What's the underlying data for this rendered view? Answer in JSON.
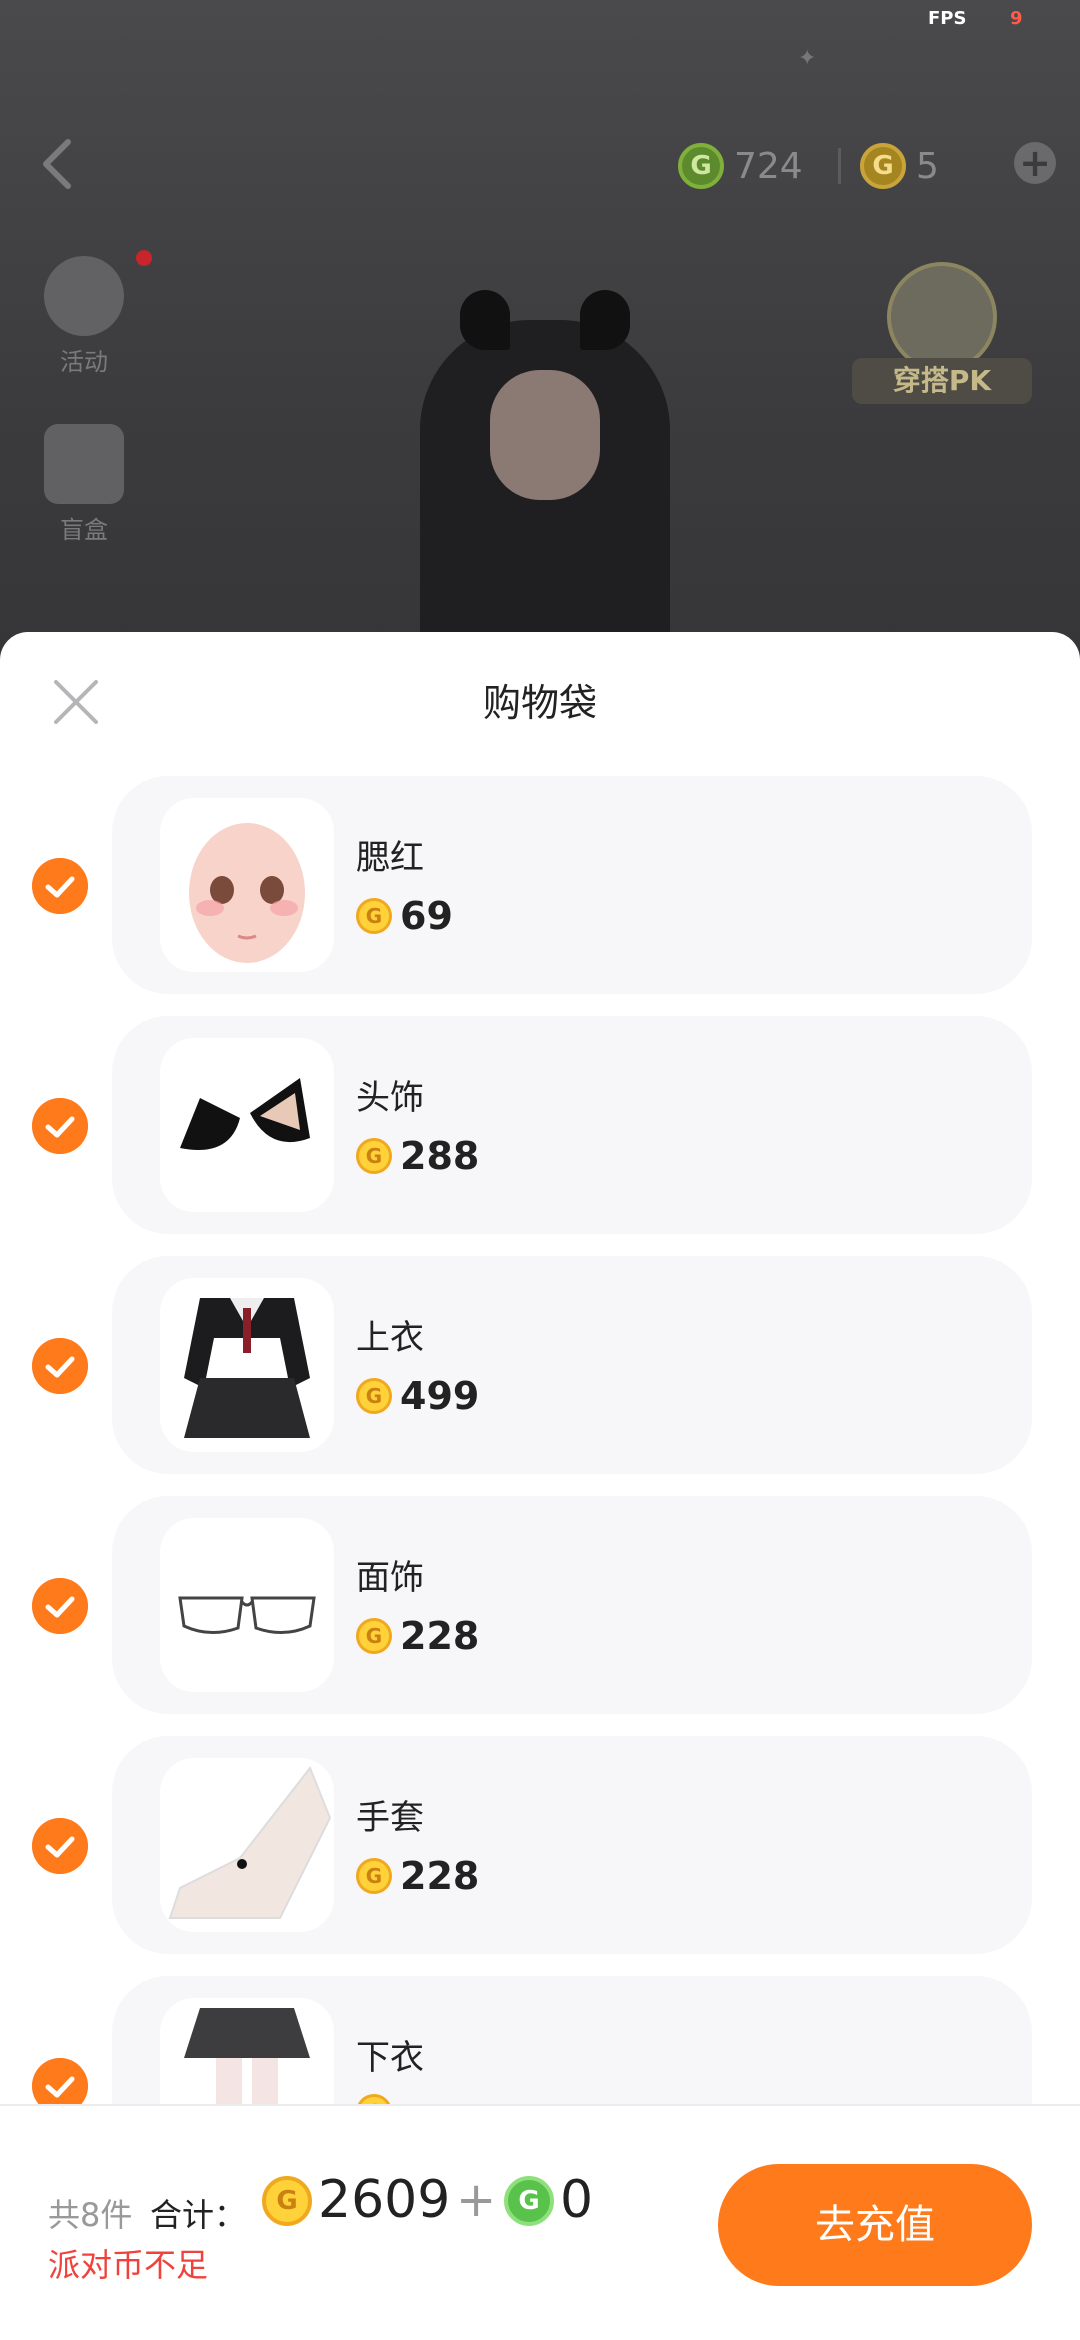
{
  "status": {
    "fps_label": "FPS",
    "fps_value": "9"
  },
  "hud": {
    "green_currency": "724",
    "gold_currency": "5",
    "activity_label": "活动",
    "blindbox_label": "盲盒",
    "pk_label": "穿搭PK"
  },
  "sheet": {
    "title": "购物袋",
    "items": [
      {
        "name": "腮红",
        "price": "69",
        "checked": true,
        "icon": "blush-face-thumb"
      },
      {
        "name": "头饰",
        "price": "288",
        "checked": true,
        "icon": "cat-ears-thumb"
      },
      {
        "name": "上衣",
        "price": "499",
        "checked": true,
        "icon": "sailor-outfit-thumb"
      },
      {
        "name": "面饰",
        "price": "228",
        "checked": true,
        "icon": "glasses-thumb"
      },
      {
        "name": "手套",
        "price": "228",
        "checked": true,
        "icon": "glove-thumb"
      },
      {
        "name": "下衣",
        "price": "",
        "checked": true,
        "icon": "plaid-skirt-thumb"
      }
    ]
  },
  "footer": {
    "count_text": "共8件",
    "total_label": "合计：",
    "total_gold": "2609",
    "plus": "+",
    "total_green": "0",
    "warning": "派对币不足",
    "recharge_label": "去充值"
  },
  "colors": {
    "accent": "#ff7a1a",
    "warning": "#f0423c",
    "card_bg": "#f7f6f9"
  }
}
